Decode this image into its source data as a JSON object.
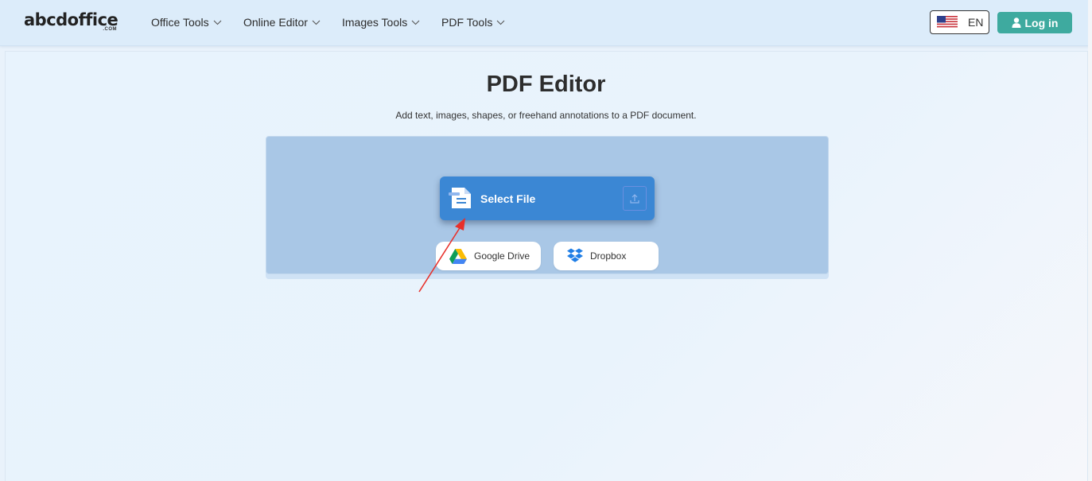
{
  "header": {
    "logo": {
      "main": "abcdoffice",
      "sub": ".COM"
    },
    "nav": [
      {
        "label": "Office Tools"
      },
      {
        "label": "Online Editor"
      },
      {
        "label": "Images Tools"
      },
      {
        "label": "PDF Tools"
      }
    ],
    "language": {
      "label": "EN",
      "flag_icon": "us-flag-icon"
    },
    "login": {
      "label": "Log in",
      "icon": "user-icon",
      "color": "#3eaa9f"
    }
  },
  "main": {
    "title": "PDF Editor",
    "subtitle": "Add text, images, shapes, or freehand annotations to a PDF document.",
    "select_file": {
      "label": "Select File",
      "icon": "document-icon",
      "upload_icon": "upload-icon",
      "color": "#3b87d4"
    },
    "cloud_sources": [
      {
        "label": "Google Drive",
        "icon": "google-drive-icon"
      },
      {
        "label": "Dropbox",
        "icon": "dropbox-icon"
      }
    ]
  },
  "annotation": {
    "arrow_color": "#e8302a",
    "points_to": "select-file-button"
  }
}
